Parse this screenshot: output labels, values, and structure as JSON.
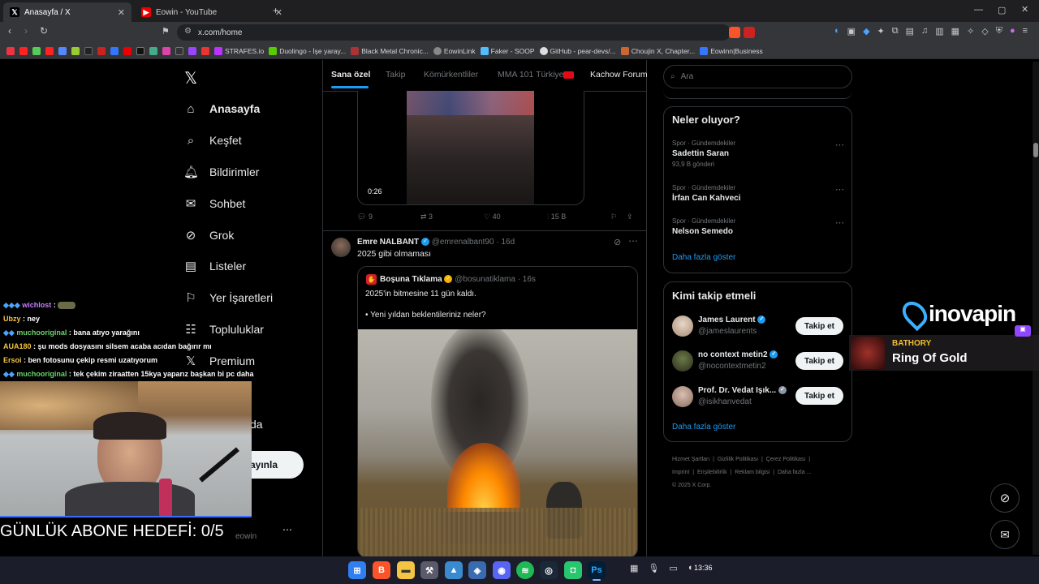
{
  "tabs": [
    {
      "title": "Anasayfa / X",
      "icon": "x-logo-icon"
    },
    {
      "title": "Eowin - YouTube",
      "icon": "youtube-icon"
    }
  ],
  "browser": {
    "url": "x.com/home"
  },
  "bookmarks": [
    {
      "label": "STRAFES.io"
    },
    {
      "label": "Duolingo - İşe yaray..."
    },
    {
      "label": "Black Metal Chronic..."
    },
    {
      "label": "EowinLink"
    },
    {
      "label": "Faker - SOOP"
    },
    {
      "label": "GitHub - pear-devs/..."
    },
    {
      "label": "Choujin X, Chapter..."
    },
    {
      "label": "Eowinn|Business"
    }
  ],
  "nav": {
    "items": [
      {
        "label": "Anasayfa",
        "icon": "home-icon"
      },
      {
        "label": "Keşfet",
        "icon": "search-icon"
      },
      {
        "label": "Bildirimler",
        "icon": "bell-icon"
      },
      {
        "label": "Sohbet",
        "icon": "mail-icon"
      },
      {
        "label": "Grok",
        "icon": "grok-icon"
      },
      {
        "label": "Listeler",
        "icon": "list-icon"
      },
      {
        "label": "Yer İşaretleri",
        "icon": "bookmark-icon"
      },
      {
        "label": "Topluluklar",
        "icon": "people-icon"
      },
      {
        "label": "Premium",
        "icon": "x-premium-icon"
      }
    ],
    "partial_more": "da",
    "post_button": "ayınla",
    "account_handle": "eowin"
  },
  "feed": {
    "tabs": [
      "Sana özel",
      "Takip",
      "Kömürkentliler",
      "MMA 101 Türkiye",
      "Kachow Forum"
    ],
    "prev_post": {
      "video_time": "0:26",
      "replies": "9",
      "reposts": "3",
      "likes": "40",
      "views": "15 B"
    },
    "post": {
      "author": "Emre NALBANT",
      "handle": "@emrenalbant90",
      "time": "· 16d",
      "text": "2025 gibi olmaması",
      "quote": {
        "author": "Boşuna Tıklama",
        "handle": "@bosunatiklama",
        "time": "· 16s",
        "line1": "2025'in bitmesine 11 gün kaldı.",
        "line2": "• Yeni yıldan beklentileriniz neler?"
      }
    }
  },
  "search": {
    "placeholder": "Ara"
  },
  "trends": {
    "title": "Neler oluyor?",
    "items": [
      {
        "context": "Spor · Gündemdekiler",
        "name": "Sadettin Saran",
        "count": "93,9 B gönderi"
      },
      {
        "context": "Spor · Gündemdekiler",
        "name": "İrfan Can Kahveci",
        "count": ""
      },
      {
        "context": "Spor · Gündemdekiler",
        "name": "Nelson Semedo",
        "count": ""
      }
    ],
    "more": "Daha fazla göster"
  },
  "who_to_follow": {
    "title": "Kimi takip etmeli",
    "items": [
      {
        "name": "James Laurent",
        "handle": "@jameslaurents",
        "button": "Takip et"
      },
      {
        "name": "no context metin2",
        "handle": "@nocontextmetin2",
        "button": "Takip et"
      },
      {
        "name": "Prof. Dr. Vedat Işık...",
        "handle": "@isikhanvedat",
        "button": "Takip et"
      }
    ],
    "more": "Daha fazla göster"
  },
  "footer": {
    "links": [
      "Hizmet Şartları",
      "Gizlilik Politikası",
      "Çerez Politikası",
      "Imprint",
      "Erişilebilirlik",
      "Reklam bilgisi",
      "Daha fazla ..."
    ],
    "copyright": "© 2025 X Corp."
  },
  "stream": {
    "chat": [
      {
        "user": "wichlost",
        "msg": ":",
        "color": "#c77dff"
      },
      {
        "user": "Ubzy",
        "msg": ": ney",
        "color": "#f4c542"
      },
      {
        "user": "muchooriginal",
        "msg": ": bana atıyo yarağını",
        "color": "#6bd36b"
      },
      {
        "user": "AUA180",
        "msg": ": şu mods dosyasını silsem acaba acıdan bağırır mı",
        "color": "#f4c542"
      },
      {
        "user": "Ersoi",
        "msg": ": ben fotosunu çekip resmi uzatıyorum",
        "color": "#f4c542"
      },
      {
        "user": "muchooriginal",
        "msg": ": tek çekim ziraatten 15kya yaparız başkan bi pc daha",
        "color": "#6bd36b"
      }
    ],
    "goal": "GÜNLÜK ABONE HEDEFİ: 0/5",
    "sponsor": "inovapin",
    "now_playing_artist": "BATHORY",
    "now_playing_title": "Ring Of Gold"
  },
  "taskbar": {
    "time": "13:36"
  },
  "colors": {
    "accent": "#1d9bf0",
    "bg": "#000000",
    "border": "#2f3336"
  }
}
